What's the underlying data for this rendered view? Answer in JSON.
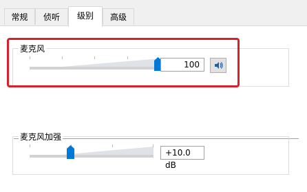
{
  "tabs": [
    {
      "label": "常规",
      "active": false
    },
    {
      "label": "侦听",
      "active": false
    },
    {
      "label": "级别",
      "active": true
    },
    {
      "label": "高级",
      "active": false
    }
  ],
  "microphone": {
    "label": "麦克风",
    "value_text": "100",
    "level": 1.0,
    "mute_icon": "speaker-icon"
  },
  "boost": {
    "label": "麦克风加强",
    "value_text": "+10.0 dB",
    "level": 0.33
  },
  "colors": {
    "accent": "#0078d7",
    "highlight": "#d9202a"
  }
}
